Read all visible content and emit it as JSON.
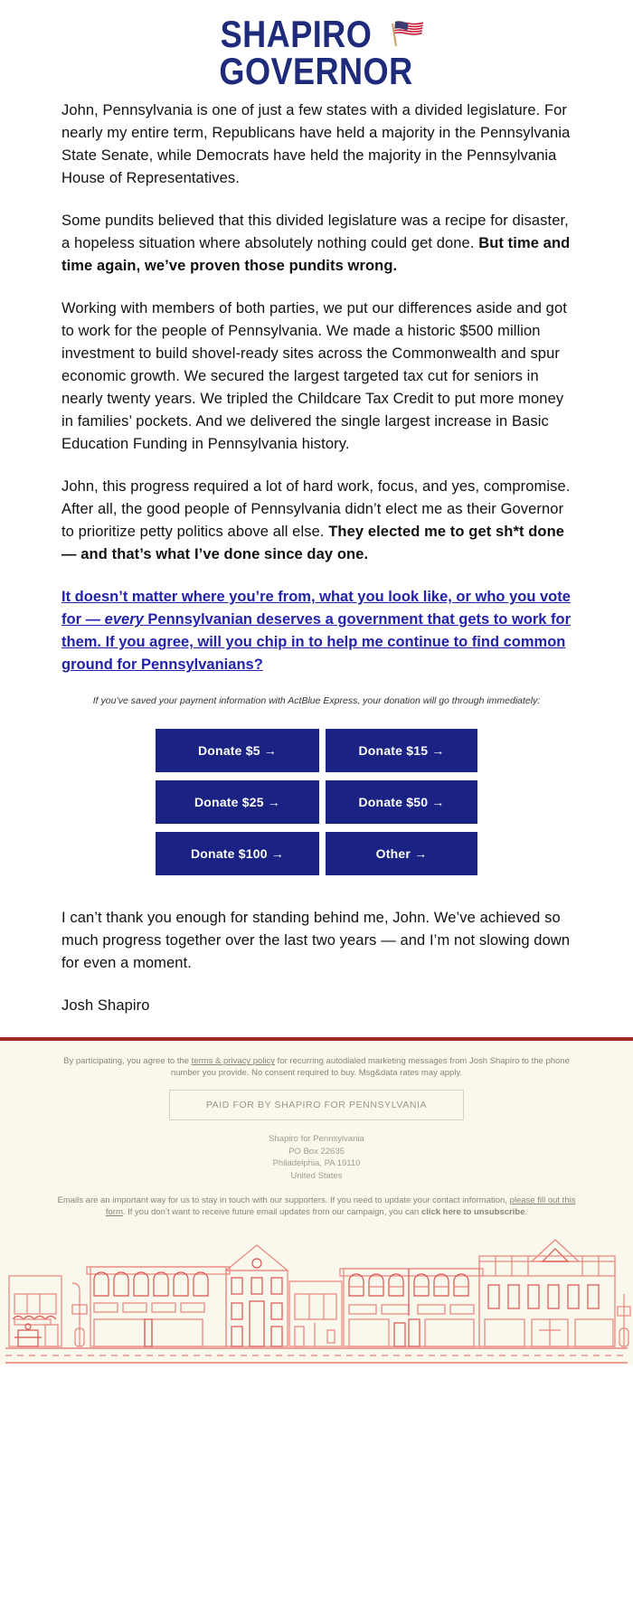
{
  "logo": {
    "line1": "SHAPIRO",
    "line2": "GOVERNOR",
    "flag_icon": "usa-flag-icon",
    "color": "#1e2a7a"
  },
  "body": {
    "p1": "John, Pennsylvania is one of just a few states with a divided legislature. For nearly my entire term, Republicans have held a majority in the Pennsylvania State Senate, while Democrats have held the majority in the Pennsylvania House of Representatives.",
    "p2_plain": "Some pundits believed that this divided legislature was a recipe for disaster, a hopeless situation where absolutely nothing could get done. ",
    "p2_bold": "But time and time again, we’ve proven those pundits wrong.",
    "p3": "Working with members of both parties, we put our differences aside and got to work for the people of Pennsylvania. We made a historic $500 million investment to build shovel-ready sites across the Commonwealth and spur economic growth. We secured the largest targeted tax cut for seniors in nearly twenty years. We tripled the Childcare Tax Credit to put more money in families’ pockets. And we delivered the single largest increase in Basic Education Funding in Pennsylvania history.",
    "p4_plain": "John, this progress required a lot of hard work, focus, and yes, compromise. After all, the good people of Pennsylvania didn’t elect me as their Governor to prioritize petty politics above all else. ",
    "p4_bold": "They elected me to get sh*t done — and that’s what I’ve done since day one.",
    "ask_part1": "It doesn’t matter where you’re from, what you look like, or who you vote for — ",
    "ask_italic": "every",
    "ask_part2": " Pennsylvanian deserves a government that gets to work for them. If you agree, will you chip in to help me continue to find common ground for Pennsylvanians?",
    "ask_color": "#2222aa",
    "express_note": "If you’ve saved your payment information with ActBlue Express, your donation will go through immediately:",
    "closing": "I can’t thank you enough for standing behind me, John. We’ve achieved so much progress together over the last two years — and I’m not slowing down for even a moment.",
    "signature": "Josh Shapiro"
  },
  "donate_buttons": [
    {
      "label": "Donate $5 →",
      "amount": "5"
    },
    {
      "label": "Donate $15 →",
      "amount": "15"
    },
    {
      "label": "Donate $25 →",
      "amount": "25"
    },
    {
      "label": "Donate $50 →",
      "amount": "50"
    },
    {
      "label": "Donate $100 →",
      "amount": "100"
    },
    {
      "label": "Other →",
      "amount": "other"
    }
  ],
  "button_color": "#1a2383",
  "footer": {
    "accent_rule_color": "#9c2b26",
    "background": "#faf7ec",
    "sms_disclaimer_pre": "By participating, you agree to the ",
    "sms_disclaimer_link": "terms & privacy policy",
    "sms_disclaimer_post": " for recurring autodialed marketing messages from Josh Shapiro to the phone number you provide. No consent required to buy. Msg&data rates may apply.",
    "paid_for": "PAID FOR BY SHAPIRO FOR PENNSYLVANIA",
    "address_line1": "Shapiro for Pennsylvania",
    "address_line2": "PO Box 22635",
    "address_line3": "Philadelphia, PA 19110",
    "address_line4": "United States",
    "email_pref_pre": "Emails are an important way for us to stay in touch with our supporters. If you need to update your contact information, ",
    "email_pref_link": "please fill out this form",
    "email_pref_mid": ". If you don’t want to receive future email updates from our campaign, you can ",
    "email_pref_unsub": "click here to unsubscribe",
    "email_pref_end": ".",
    "illustration": "main-street-storefronts-illustration"
  }
}
